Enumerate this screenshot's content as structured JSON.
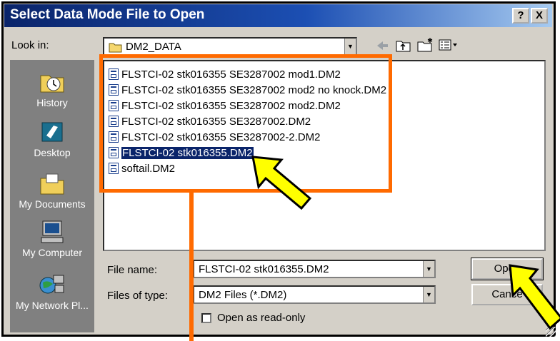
{
  "window": {
    "title": "Select Data Mode File to Open",
    "help_label": "?",
    "close_label": "X"
  },
  "look_in": {
    "label": "Look in:",
    "value": "DM2_DATA"
  },
  "places": [
    {
      "label": "History",
      "icon": "history-icon"
    },
    {
      "label": "Desktop",
      "icon": "desktop-icon"
    },
    {
      "label": "My Documents",
      "icon": "my-documents-icon"
    },
    {
      "label": "My Computer",
      "icon": "my-computer-icon"
    },
    {
      "label": "My Network Pl...",
      "icon": "network-places-icon"
    }
  ],
  "files": [
    {
      "name": "FLSTCI-02 stk016355 SE3287002 mod1.DM2",
      "selected": false
    },
    {
      "name": "FLSTCI-02 stk016355 SE3287002 mod2 no knock.DM2",
      "selected": false
    },
    {
      "name": "FLSTCI-02 stk016355 SE3287002 mod2.DM2",
      "selected": false
    },
    {
      "name": "FLSTCI-02 stk016355 SE3287002.DM2",
      "selected": false
    },
    {
      "name": "FLSTCI-02 stk016355 SE3287002-2.DM2",
      "selected": false
    },
    {
      "name": "FLSTCI-02 stk016355.DM2",
      "selected": true
    },
    {
      "name": "softail.DM2",
      "selected": false
    }
  ],
  "file_name": {
    "label": "File name:",
    "value": "FLSTCI-02 stk016355.DM2"
  },
  "file_type": {
    "label": "Files of type:",
    "value": "DM2 Files (*.DM2)"
  },
  "readonly": {
    "label": "Open as read-only",
    "checked": false
  },
  "buttons": {
    "open": "Open",
    "cancel": "Cance"
  },
  "annotation_colors": {
    "highlight_box": "#ff6a00",
    "arrow_fill": "#ffff00",
    "arrow_outline": "#000000"
  }
}
